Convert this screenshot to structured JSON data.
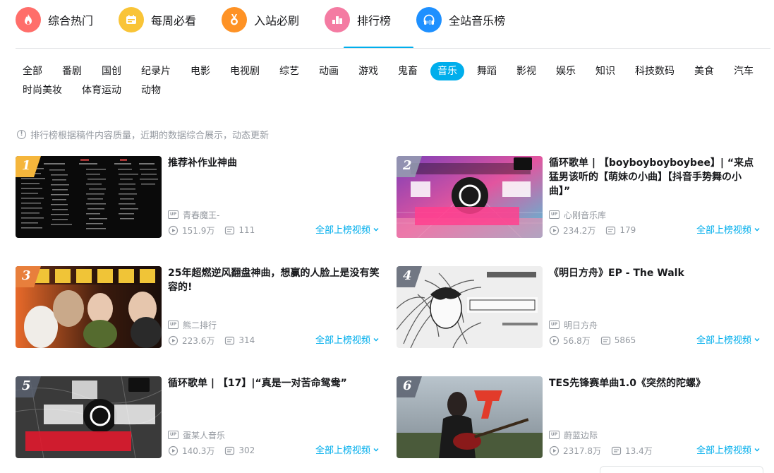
{
  "nav": {
    "items": [
      {
        "label": "综合热门",
        "color": "#ff6e6a",
        "icon": "fire-icon"
      },
      {
        "label": "每周必看",
        "color": "#f9c437",
        "icon": "calendar-icon"
      },
      {
        "label": "入站必刷",
        "color": "#fe9225",
        "icon": "medal-icon"
      },
      {
        "label": "排行榜",
        "color": "#f47ba2",
        "icon": "rank-bars-icon"
      },
      {
        "label": "全站音乐榜",
        "color": "#1e90ff",
        "icon": "headphones-icon"
      }
    ],
    "active_index": 3
  },
  "categories": [
    "全部",
    "番剧",
    "国创",
    "纪录片",
    "电影",
    "电视剧",
    "综艺",
    "动画",
    "游戏",
    "鬼畜",
    "音乐",
    "舞蹈",
    "影视",
    "娱乐",
    "知识",
    "科技数码",
    "美食",
    "汽车",
    "时尚美妆",
    "体育运动",
    "动物"
  ],
  "active_category": "音乐",
  "notice": "排行榜根据稿件内容质量，近期的数据综合展示，动态更新",
  "up_badge": "UP",
  "link_label": "全部上榜视频",
  "accent": "#00aeec",
  "cards": [
    {
      "rank": "1",
      "title": "推荐补作业神曲",
      "up": "青春魔王-",
      "plays": "151.9万",
      "danmaku": "111"
    },
    {
      "rank": "2",
      "title": "循环歌单 | 【boyboyboyboybee】| “来点猛男该听的【萌妹の小曲】【抖音手势舞の小曲】”",
      "up": "心刚音乐库",
      "plays": "234.2万",
      "danmaku": "179"
    },
    {
      "rank": "3",
      "title": "25年超燃逆风翻盘神曲，想赢的人脸上是没有笑容的!",
      "up": "熊二排行",
      "plays": "223.6万",
      "danmaku": "314"
    },
    {
      "rank": "4",
      "title": "《明日方舟》EP - The Walk",
      "up": "明日方舟",
      "plays": "56.8万",
      "danmaku": "5865"
    },
    {
      "rank": "5",
      "title": "循环歌单 | 【17】|“真是一对苦命鸳鸯”",
      "up": "蛋某人音乐",
      "plays": "140.3万",
      "danmaku": "302"
    },
    {
      "rank": "6",
      "title": "TES先锋赛单曲1.0《突然的陀螺》",
      "up": "蔚蓝边际",
      "plays": "2317.8万",
      "danmaku": "13.4万"
    }
  ]
}
